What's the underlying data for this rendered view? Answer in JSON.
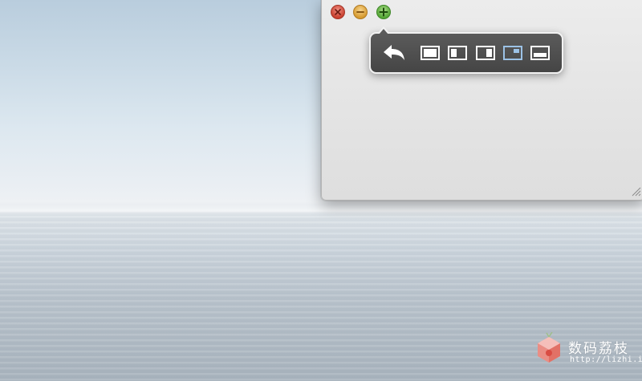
{
  "desktop": {
    "wallpaper": "calm sea horizon"
  },
  "window": {
    "traffic_lights": [
      {
        "name": "close",
        "color": "#d9503e",
        "icon": "close-icon"
      },
      {
        "name": "minimize",
        "color": "#e0a83a",
        "icon": "minimize-icon"
      },
      {
        "name": "zoom",
        "color": "#6cbd45",
        "icon": "plus-icon"
      }
    ]
  },
  "snap_menu": {
    "buttons": [
      {
        "name": "restore",
        "icon": "undo-arrow-icon"
      },
      {
        "name": "fullscreen",
        "icon": "layout-full-icon"
      },
      {
        "name": "left-half",
        "icon": "layout-left-half-icon"
      },
      {
        "name": "right-half",
        "icon": "layout-right-half-icon"
      },
      {
        "name": "top-right-quarter",
        "icon": "layout-top-right-icon",
        "highlighted": true
      },
      {
        "name": "bottom-half",
        "icon": "layout-bottom-half-icon"
      }
    ],
    "highlight_color": "#9cc2e6"
  },
  "watermark": {
    "title": "数码荔枝",
    "url": "http://lizhi.io",
    "logo": "lychee-cube-logo"
  }
}
